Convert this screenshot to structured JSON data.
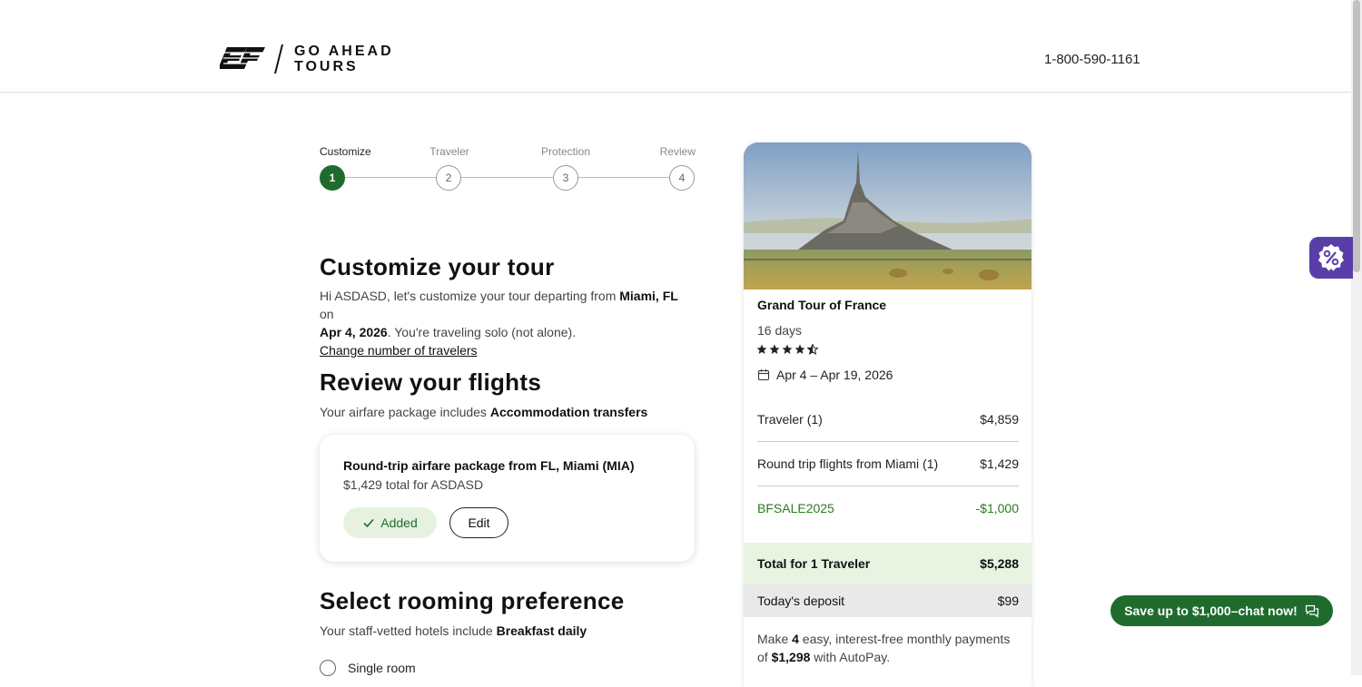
{
  "header": {
    "logo_text_line1": "GO AHEAD",
    "logo_text_line2": "TOURS",
    "phone": "1-800-590-1161"
  },
  "stepper": {
    "steps": [
      {
        "label": "Customize",
        "number": "1",
        "active": true
      },
      {
        "label": "Traveler",
        "number": "2",
        "active": false
      },
      {
        "label": "Protection",
        "number": "3",
        "active": false
      },
      {
        "label": "Review",
        "number": "4",
        "active": false
      }
    ]
  },
  "customize": {
    "title": "Customize your tour",
    "greeting_pre": "Hi ASDASD, let's customize your tour departing from ",
    "departure_city": "Miami, FL",
    "greeting_on": " on",
    "departure_date": "Apr 4, 2026",
    "greeting_post": ". You're traveling solo (not alone).",
    "change_travelers_link": "Change number of travelers"
  },
  "flights": {
    "title": "Review your flights",
    "subtitle_pre": "Your airfare package includes ",
    "subtitle_bold": "Accommodation transfers",
    "card_title": "Round-trip airfare package from FL, Miami (MIA)",
    "card_subtitle": "$1,429 total for ASDASD",
    "added_label": "Added",
    "edit_label": "Edit"
  },
  "rooming": {
    "title": "Select rooming preference",
    "subtitle_pre": "Your staff-vetted hotels include ",
    "subtitle_bold": "Breakfast daily",
    "options": [
      {
        "label": "Single room"
      }
    ]
  },
  "summary": {
    "tour_name": "Grand Tour of France",
    "duration": "16 days",
    "rating": 4.5,
    "dates": "Apr 4 – Apr 19, 2026",
    "lines": [
      {
        "label": "Traveler (1)",
        "amount": "$4,859"
      },
      {
        "label": "Round trip flights from Miami (1)",
        "amount": "$1,429"
      },
      {
        "label": "BFSALE2025",
        "amount": "-$1,000"
      }
    ],
    "total_label": "Total for 1 Traveler",
    "total_amount": "$5,288",
    "deposit_label": "Today's deposit",
    "deposit_amount": "$99",
    "autopay_pre": "Make ",
    "autopay_count": "4",
    "autopay_mid": " easy, interest-free monthly payments of ",
    "autopay_amount": "$1,298",
    "autopay_post": " with AutoPay."
  },
  "chat": {
    "label": "Save up to $1,000–chat now!"
  },
  "colors": {
    "brand_green": "#1f6b2e",
    "promo_purple": "#5a3ea8",
    "total_band": "#e8f3e2"
  }
}
